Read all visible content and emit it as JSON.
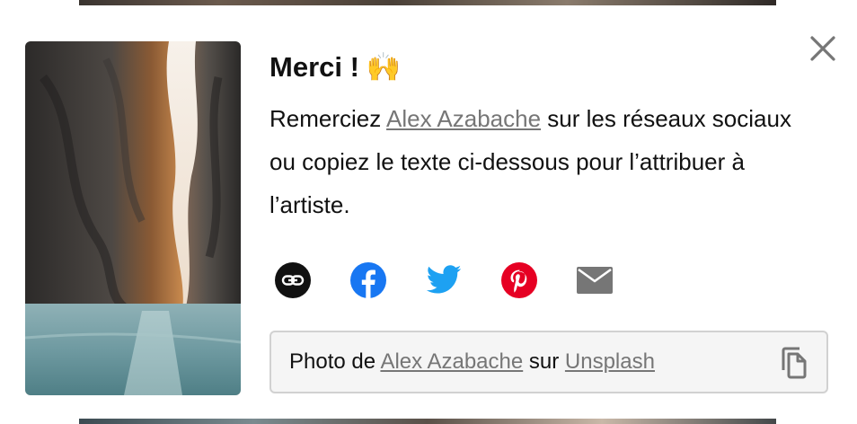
{
  "modal": {
    "title": "Merci !",
    "title_emoji": "🙌",
    "desc_prefix": "Remerciez ",
    "artist_name": "Alex Azabache",
    "desc_suffix": " sur les réseaux sociaux ou copiez le texte ci-dessous pour l’attribuer à l’artiste.",
    "close_icon": "close-icon"
  },
  "share": {
    "icons": [
      "link-icon",
      "facebook-icon",
      "twitter-icon",
      "pinterest-icon",
      "mail-icon"
    ],
    "colors": {
      "link": "#111111",
      "facebook": "#1877F2",
      "twitter": "#1DA1F2",
      "pinterest": "#E60023",
      "mail": "#767676"
    }
  },
  "credit": {
    "prefix": "Photo de ",
    "artist": "Alex Azabache",
    "middle": " sur ",
    "source": "Unsplash",
    "copy_icon": "copy-icon"
  }
}
